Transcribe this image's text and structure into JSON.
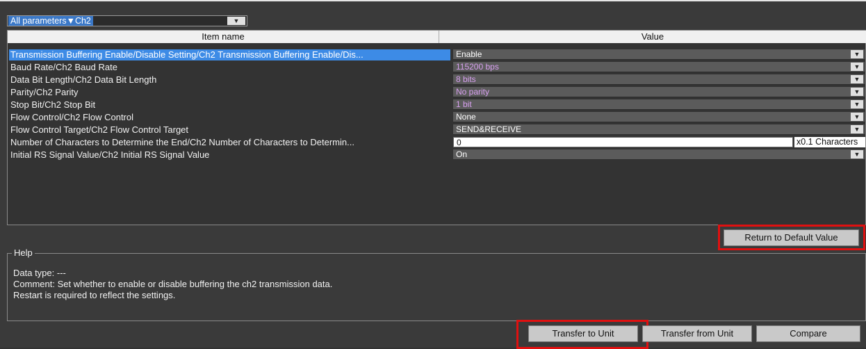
{
  "filter": {
    "value": "All parameters▼Ch2"
  },
  "columns": {
    "item_name": "Item name",
    "value": "Value"
  },
  "rows": [
    {
      "name": "Transmission Buffering Enable/Disable Setting/Ch2 Transmission Buffering Enable/Dis...",
      "value": "Enable"
    },
    {
      "name": "Baud Rate/Ch2 Baud Rate",
      "value": "115200 bps"
    },
    {
      "name": "Data Bit Length/Ch2 Data Bit Length",
      "value": "8 bits"
    },
    {
      "name": "Parity/Ch2 Parity",
      "value": "No parity"
    },
    {
      "name": "Stop Bit/Ch2 Stop Bit",
      "value": "1 bit"
    },
    {
      "name": "Flow Control/Ch2 Flow Control",
      "value": "None"
    },
    {
      "name": "Flow Control Target/Ch2 Flow Control Target",
      "value": "SEND&RECEIVE"
    },
    {
      "name": "Number of Characters to Determine the End/Ch2 Number of Characters to Determin...",
      "value": "0",
      "unit": "x0.1 Characters"
    },
    {
      "name": "Initial RS Signal Value/Ch2 Initial RS Signal Value",
      "value": "On"
    }
  ],
  "buttons": {
    "return_default": "Return to Default Value",
    "transfer_to_unit": "Transfer to Unit",
    "transfer_from_unit": "Transfer from Unit",
    "compare": "Compare"
  },
  "help": {
    "title": "Help",
    "data_type": "Data type: ---",
    "comment": "Comment: Set whether to enable or disable buffering the ch2 transmission data.",
    "restart": "Restart is required to reflect the settings."
  },
  "colors": {
    "selection": "#3d8be6",
    "default_value_text": "#d8a0f0",
    "highlight": "#e01010"
  },
  "icons": {
    "dropdown": "▼"
  }
}
